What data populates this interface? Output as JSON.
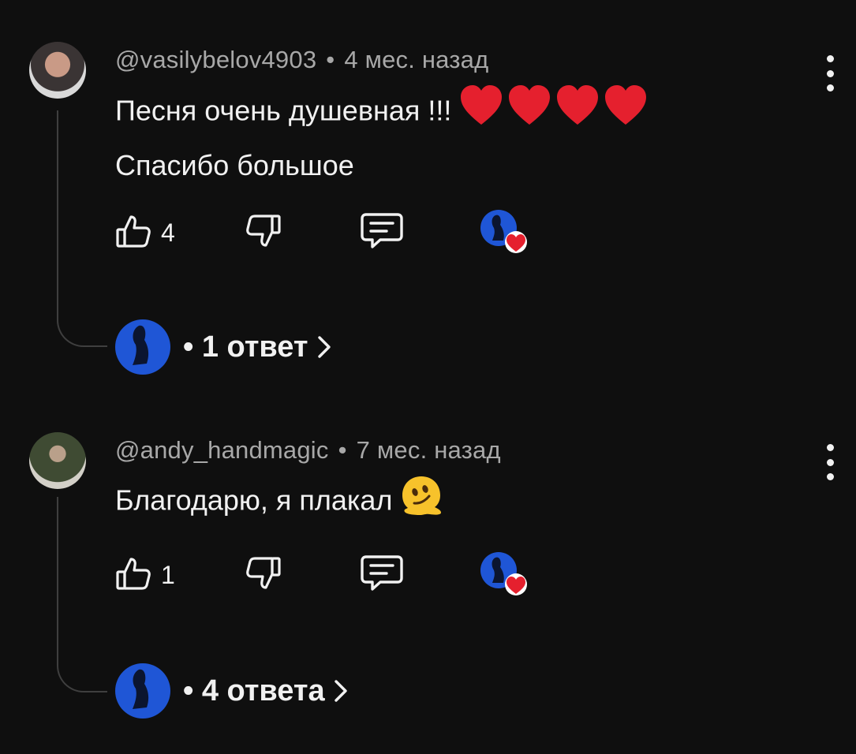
{
  "comments": [
    {
      "author": "@vasilybelov4903",
      "separator": "•",
      "time": "4 мес. назад",
      "line1": "Песня очень душевная !!!",
      "line2": "Спасибо большое",
      "likes": "4",
      "replies": "• 1 ответ",
      "emoji": "red-heart-x4"
    },
    {
      "author": "@andy_handmagic",
      "separator": "•",
      "time": "7 мес. назад",
      "line1": "Благодарю, я плакал",
      "likes": "1",
      "replies": "• 4 ответа",
      "emoji": "melting-face"
    }
  ],
  "colors": {
    "background": "#0f0f0f",
    "meta_text": "#a8a8a8",
    "text": "#f1f1f1",
    "creator_avatar": "#1f56d6",
    "heart": "#e5202e",
    "thread_line": "#3f3f3f"
  }
}
